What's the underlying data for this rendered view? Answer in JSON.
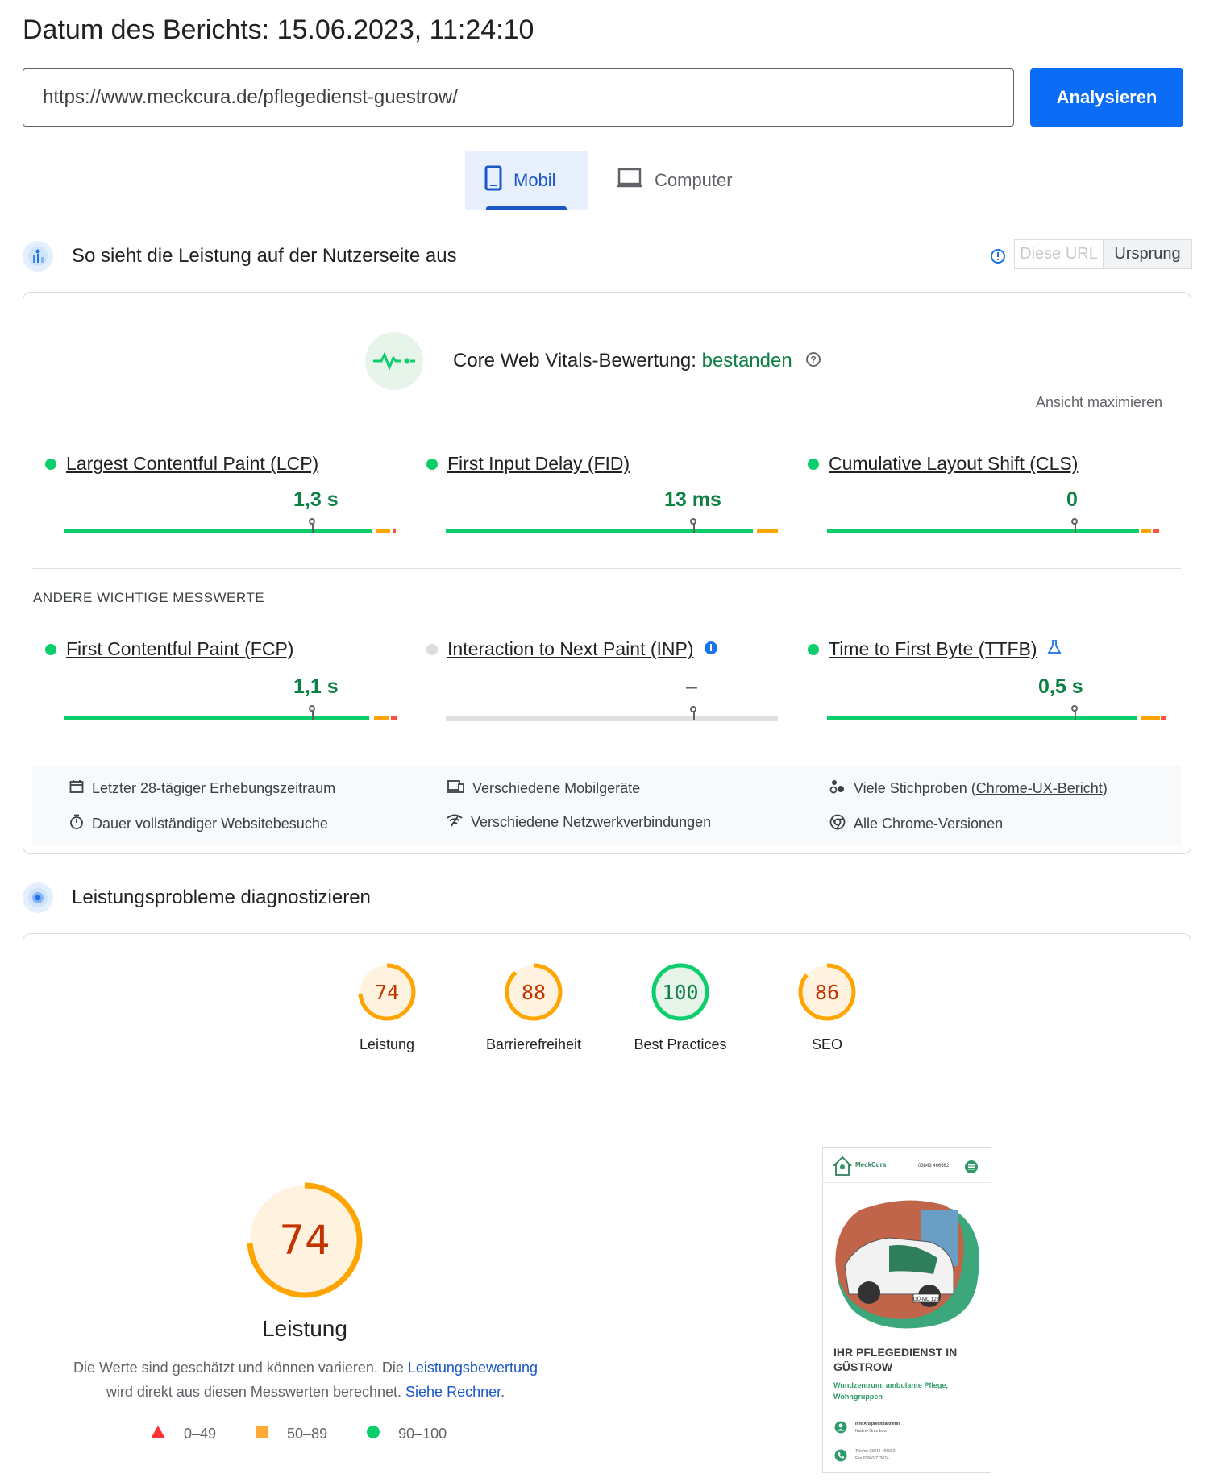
{
  "header": {
    "report_date": "Datum des Berichts: 15.06.2023, 11:24:10",
    "url_value": "https://www.meckcura.de/pflegedienst-guestrow/",
    "analyze_label": "Analysieren"
  },
  "device_tabs": {
    "mobile_label": "Mobil",
    "desktop_label": "Computer",
    "selected": "Mobil"
  },
  "field_section": {
    "title": "So sieht die Leistung auf der Nutzerseite aus",
    "toggle_this_url": "Diese URL",
    "toggle_origin": "Ursprung",
    "cwv_label": "Core Web Vitals-Bewertung:",
    "cwv_status": "bestanden",
    "maximize": "Ansicht maximieren",
    "core_metrics": [
      {
        "name": "Largest Contentful Paint (LCP)",
        "value": "1,3 s",
        "status": "good",
        "distribution": {
          "good": 0.92,
          "needs_improvement": 0.05,
          "poor": 0.01
        }
      },
      {
        "name": "First Input Delay (FID)",
        "value": "13 ms",
        "status": "good",
        "distribution": {
          "good": 0.92,
          "needs_improvement": 0.06,
          "poor": 0.0
        }
      },
      {
        "name": "Cumulative Layout Shift (CLS)",
        "value": "0",
        "status": "good",
        "distribution": {
          "good": 0.94,
          "needs_improvement": 0.03,
          "poor": 0.02
        }
      }
    ],
    "other_heading": "ANDERE WICHTIGE MESSWERTE",
    "other_metrics": [
      {
        "name": "First Contentful Paint (FCP)",
        "value": "1,1 s",
        "status": "good",
        "distribution": {
          "good": 0.92,
          "needs_improvement": 0.04,
          "poor": 0.02
        }
      },
      {
        "name": "Interaction to Next Paint (INP)",
        "value": "–",
        "status": "no-data"
      },
      {
        "name": "Time to First Byte (TTFB)",
        "value": "0,5 s",
        "status": "good",
        "distribution": {
          "good": 0.91,
          "needs_improvement": 0.06,
          "poor": 0.02
        }
      }
    ],
    "info_items": {
      "period": "Letzter 28-tägiger Erhebungszeitraum",
      "devices": "Verschiedene Mobilgeräte",
      "samples_prefix": "Viele Stichproben (",
      "samples_link": "Chrome-UX-Bericht",
      "samples_suffix": ")",
      "duration": "Dauer vollständiger Websitebesuche",
      "network": "Verschiedene Netzwerkverbindungen",
      "versions": "Alle Chrome-Versionen"
    }
  },
  "diagnose_section": {
    "title": "Leistungsprobleme diagnostizieren",
    "scores": [
      {
        "label": "Leistung",
        "score": 74,
        "rating": "average"
      },
      {
        "label": "Barrierefreiheit",
        "score": 88,
        "rating": "average"
      },
      {
        "label": "Best Practices",
        "score": 100,
        "rating": "pass"
      },
      {
        "label": "SEO",
        "score": 86,
        "rating": "average"
      }
    ],
    "main_score": "74",
    "main_label": "Leistung",
    "explain_1": "Die Werte sind geschätzt und können variieren. Die ",
    "explain_link_1": "Leistungsbewertung",
    "explain_2": "wird direkt aus diesen Messwerten berechnet. ",
    "explain_link_2": "Siehe Rechner",
    "explain_end": ".",
    "legend": [
      {
        "range": "0–49",
        "shape": "triangle",
        "color": "#ff3333"
      },
      {
        "range": "50–89",
        "shape": "square",
        "color": "#ffaa33"
      },
      {
        "range": "90–100",
        "shape": "circle",
        "color": "#0cce6b"
      }
    ]
  },
  "thumbnail": {
    "brand": "MeckCura",
    "phone": "03843 466662",
    "headline": "IHR PFLEGEDIENST IN GÜSTROW",
    "subline": "Wundzentrum, ambulante Pflege, Wohngruppen",
    "contact_title": "Ihre Ansprechpartnerin",
    "contact_name": "Nadine Grambow",
    "tel": "Telefon 03843 466662",
    "fax": "Fax 03843 773674",
    "plate": "GÜ-MC 123"
  },
  "colors": {
    "good": "#0cce6b",
    "needs_improvement": "#ffa400",
    "poor": "#ff4e42",
    "accent": "#0b6df5",
    "pass_text": "#0d8043",
    "average_text": "#c33300"
  }
}
